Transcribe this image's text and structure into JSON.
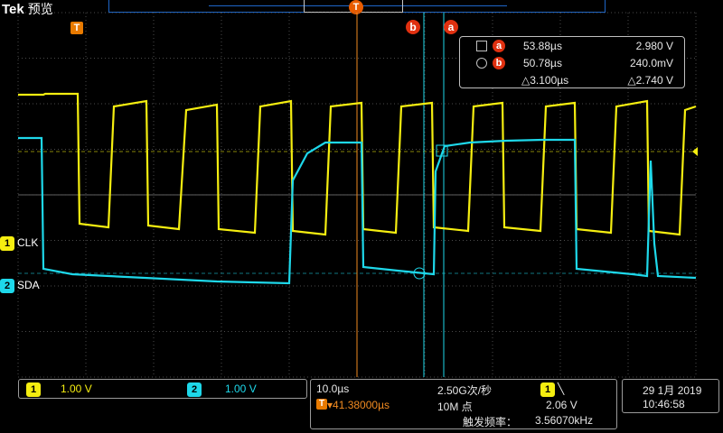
{
  "brand": {
    "name": "Tek",
    "mode": "预览"
  },
  "markers": {
    "trigger_T": "T",
    "trigger_pos": "T",
    "cursor_a": "a",
    "cursor_b": "b"
  },
  "cursor_readout": {
    "rows": [
      {
        "symbol": "square-icon",
        "tag": "a",
        "time": "53.88µs",
        "value": "2.980 V"
      },
      {
        "symbol": "circle-icon",
        "tag": "b",
        "time": "50.78µs",
        "value": "240.0mV"
      }
    ],
    "delta_time": "△3.100µs",
    "delta_value": "△2.740 V"
  },
  "channels": [
    {
      "id": "1",
      "name": "CLK",
      "scale": "1.00 V",
      "color": "#f5ee10"
    },
    {
      "id": "2",
      "name": "SDA",
      "scale": "1.00 V",
      "color": "#1ed8ea"
    }
  ],
  "timebase": {
    "scale": "10.0µs",
    "sample_rate": "2.50G次/秒",
    "trigger_delay": "41.38000µs",
    "record_length": "10M 点",
    "trigger_channel": "1",
    "trigger_slope_icon": "falling-edge-icon",
    "trigger_level": "2.06 V",
    "trigger_freq_label": "触发频率：",
    "trigger_freq": "3.56070kHz"
  },
  "datetime": {
    "date": "29 1月 2019",
    "time": "10:46:58"
  }
}
